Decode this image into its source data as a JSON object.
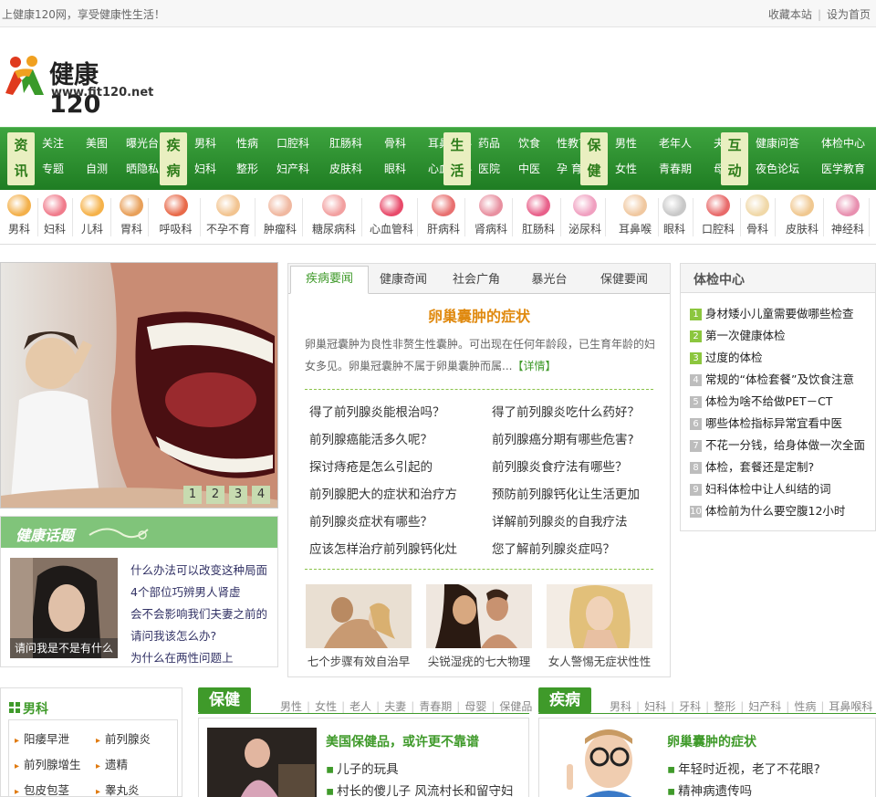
{
  "topbar": {
    "greeting": "上健康120网，享受健康性生活！",
    "bookmark": "收藏本站",
    "sep": "|",
    "homepage": "设为首页"
  },
  "logo": {
    "name": "健康120",
    "url": "www.fit120.net"
  },
  "nav": [
    {
      "tag": [
        "资",
        "讯"
      ],
      "rows": [
        [
          "关注",
          "美图",
          "曝光台"
        ],
        [
          "专题",
          "自测",
          "晒隐私"
        ]
      ]
    },
    {
      "tag": [
        "疾",
        "病"
      ],
      "rows": [
        [
          "男科",
          "性病",
          "口腔科",
          "肛肠科",
          "骨科",
          "耳鼻喉科"
        ],
        [
          "妇科",
          "整形",
          "妇产科",
          "皮肤科",
          "眼科",
          "心血管科"
        ]
      ]
    },
    {
      "tag": [
        "生",
        "活"
      ],
      "rows": [
        [
          "药品",
          "饮食",
          "性教育"
        ],
        [
          "医院",
          "中医",
          "孕 育"
        ]
      ]
    },
    {
      "tag": [
        "保",
        "健"
      ],
      "rows": [
        [
          "男性",
          "老年人",
          "夫妻"
        ],
        [
          "女性",
          "青春期",
          "母婴"
        ]
      ]
    },
    {
      "tag": [
        "互",
        "动"
      ],
      "rows": [
        [
          "健康问答",
          "体检中心"
        ],
        [
          "夜色论坛",
          "医学教育"
        ]
      ]
    }
  ],
  "departments": [
    "男科",
    "妇科",
    "儿科",
    "胃科",
    "呼吸科",
    "不孕不育",
    "肿瘤科",
    "糖尿病科",
    "心血管科",
    "肝病科",
    "肾病科",
    "肛肠科",
    "泌尿科",
    "耳鼻喉",
    "眼科",
    "口腔科",
    "骨科",
    "皮肤科",
    "神经科"
  ],
  "slideshow": {
    "pages": [
      "1",
      "2",
      "3",
      "4"
    ]
  },
  "topic": {
    "title": "健康话题",
    "image_caption": "请问我是不是有什么",
    "items": [
      "什么办法可以改变这种局面",
      "4个部位巧辨男人肾虚",
      "会不会影响我们夫妻之前的",
      "请问我该怎么办?",
      "为什么在两性问题上"
    ]
  },
  "news": {
    "tabs": [
      "疾病要闻",
      "健康奇闻",
      "社会广角",
      "暴光台",
      "保健要闻"
    ],
    "headline": "卵巢囊肿的症状",
    "summary": "卵巢冠囊肿为良性非赘生性囊肿。可出现在任何年龄段，已生育年龄的妇女多见。卵巢冠囊肿不属于卵巢囊肿而属...",
    "more": "【详情】",
    "links_left": [
      "得了前列腺炎能根治吗？",
      "前列腺癌能活多久呢？",
      "探讨痔疮是怎么引起的",
      "前列腺肥大的症状和治疗方",
      "前列腺炎症状有哪些？",
      "应该怎样治疗前列腺钙化灶"
    ],
    "links_right": [
      "得了前列腺炎吃什么药好？",
      "前列腺癌分期有哪些危害?",
      "前列腺炎食疗法有哪些？",
      "预防前列腺钙化让生活更加",
      "详解前列腺炎的自我疗法",
      "您了解前列腺炎症吗？"
    ],
    "thumbs": [
      "七个步骤有效自治早",
      "尖锐湿疣的七大物理",
      "女人警惕无症状性性"
    ]
  },
  "checkup": {
    "title": "体检中心",
    "items": [
      "身材矮小儿童需要做哪些检查",
      "第一次健康体检",
      "过度的体检",
      "常规的“体检套餐”及饮食注意",
      "体检为啥不给做PET－CT",
      "哪些体检指标异常宜看中医",
      "不花一分钱，给身体做一次全面",
      "体检，套餐还是定制?",
      "妇科体检中让人纠结的词",
      "体检前为什么要空腹12小时"
    ],
    "nums": [
      "1",
      "2",
      "3",
      "4",
      "5",
      "6",
      "7",
      "8",
      "9",
      "10"
    ]
  },
  "men": {
    "title": "男科",
    "items": [
      "阳痿早泄",
      "前列腺炎",
      "前列腺增生",
      "遗精",
      "包皮包茎",
      "睾丸炎"
    ]
  },
  "health": {
    "badge": "保健",
    "links": [
      "男性",
      "女性",
      "老人",
      "夫妻",
      "青春期",
      "母婴",
      "保健品"
    ],
    "title": "美国保健品，或许更不靠谱",
    "items": [
      "儿子的玩具",
      "村长的傻儿子 风流村长和留守妇"
    ]
  },
  "disease": {
    "badge": "疾病",
    "links": [
      "男科",
      "妇科",
      "牙科",
      "整形",
      "妇产科",
      "性病",
      "耳鼻喉科"
    ],
    "title": "卵巢囊肿的症状",
    "items": [
      "年轻时近视，老了不花眼?",
      "精神病遗传吗"
    ]
  },
  "colors": {
    "green": "#3f9a2a",
    "orange": "#e08a10",
    "nav_top": "#3ea43f",
    "nav_bottom": "#1f7d23"
  }
}
